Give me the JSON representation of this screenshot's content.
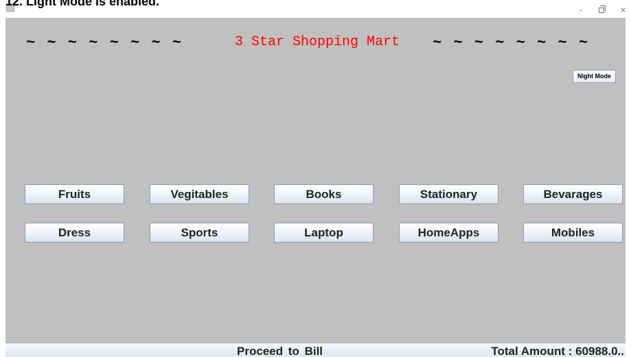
{
  "caption": "12. Light Mode is enabled.",
  "window": {
    "controls": {
      "minimize": "–",
      "close": "×"
    }
  },
  "header": {
    "tildes_left": "~ ~ ~ ~ ~ ~ ~ ~",
    "title": "3 Star Shopping Mart",
    "tildes_right": "~ ~ ~ ~ ~ ~ ~ ~",
    "title_color": "#ff0000"
  },
  "night_mode_label": "Night Mode",
  "categories": {
    "row1": [
      "Fruits",
      "Vegitables",
      "Books",
      "Stationary",
      "Bevarages"
    ],
    "row2": [
      "Dress",
      "Sports",
      "Laptop",
      "HomeApps",
      "Mobiles"
    ]
  },
  "footer": {
    "proceed_label": "Proceed to Bill",
    "total_label": "Total Amount : 60988.0.."
  },
  "colors": {
    "background": "#c0c0c0",
    "title_text": "#ff0000"
  }
}
